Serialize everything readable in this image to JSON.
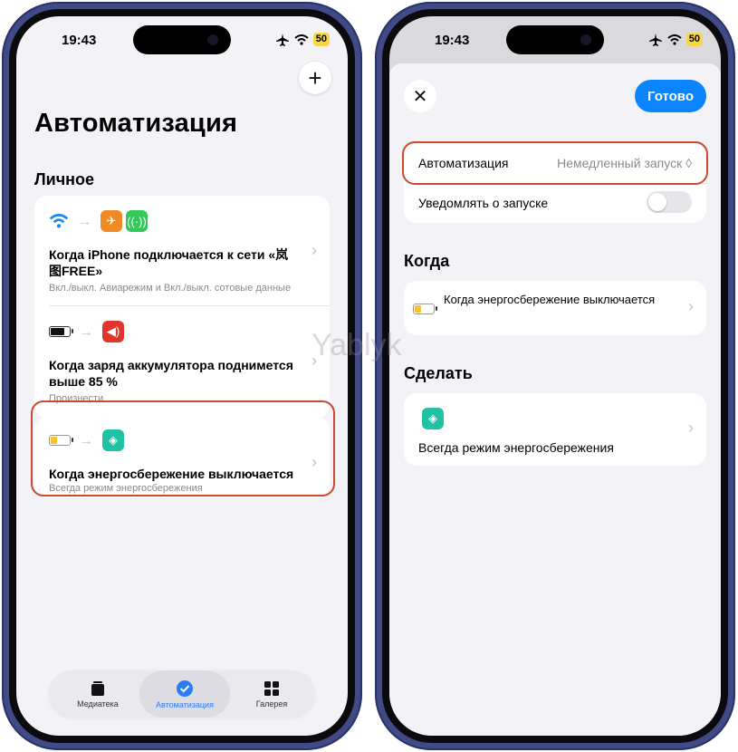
{
  "status_bar": {
    "time": "19:43",
    "battery": "50"
  },
  "left": {
    "add_symbol": "+",
    "title": "Автоматизация",
    "section": "Личное",
    "automations": [
      {
        "title": "Когда iPhone подключается к сети «岚图FREE»",
        "subtitle": "Вкл./выкл. Авиарежим и Вкл./выкл. сотовые данные"
      },
      {
        "title": "Когда заряд аккумулятора поднимется выше 85 %",
        "subtitle": "Произнести"
      },
      {
        "title": "Когда энергосбережение выключается",
        "subtitle": "Всегда режим энергосбережения"
      }
    ],
    "tabs": [
      {
        "label": "Медиатека"
      },
      {
        "label": "Автоматизация"
      },
      {
        "label": "Галерея"
      }
    ]
  },
  "right": {
    "close_symbol": "✕",
    "done_label": "Готово",
    "automation_label": "Автоматизация",
    "automation_value": "Немедленный запуск ◊",
    "notify_label": "Уведомлять о запуске",
    "when_header": "Когда",
    "when_item": "Когда энергосбережение выключается",
    "do_header": "Сделать",
    "do_item": "Всегда режим энергосбережения"
  },
  "watermark": "Yablyk",
  "colors": {
    "accent": "#0a84ff",
    "highlight": "#c94a2e",
    "frame": "#3f4a86"
  }
}
